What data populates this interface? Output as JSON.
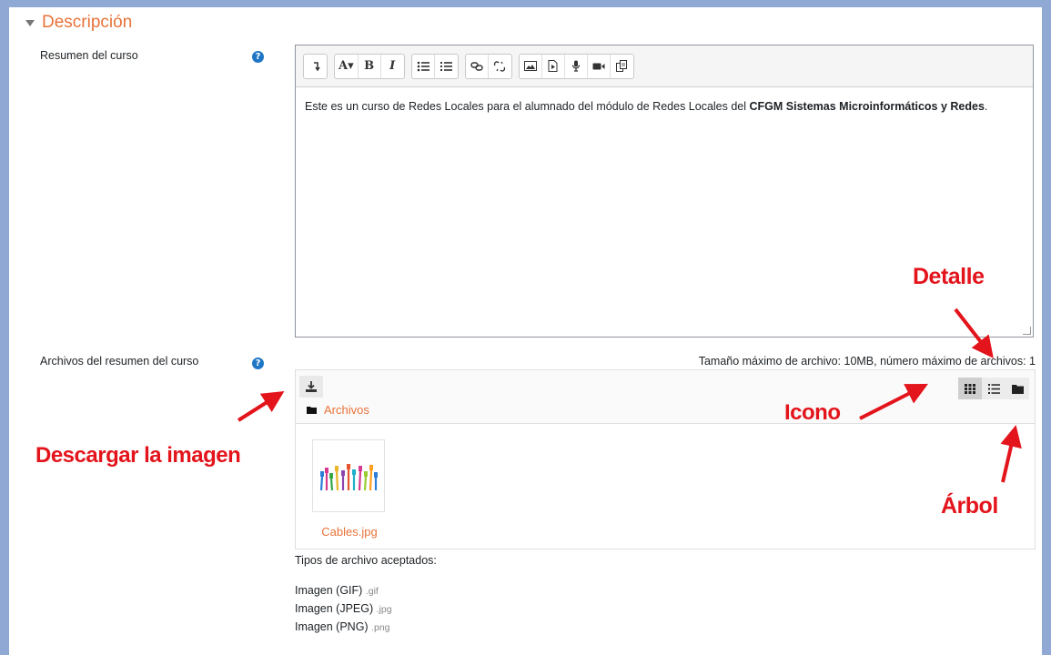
{
  "section": {
    "title": "Descripción"
  },
  "summary": {
    "label": "Resumen del curso",
    "help_glyph": "?",
    "toolbar": [
      {
        "name": "collapse",
        "icon": "collapse-icon"
      },
      {
        "name": "font-style",
        "text": "A▾"
      },
      {
        "name": "bold",
        "text": "B"
      },
      {
        "name": "italic",
        "text": "I"
      },
      {
        "name": "unordered-list",
        "icon": "unordered-list-icon"
      },
      {
        "name": "ordered-list",
        "icon": "ordered-list-icon"
      },
      {
        "name": "link",
        "icon": "link-icon"
      },
      {
        "name": "unlink",
        "icon": "unlink-icon"
      },
      {
        "name": "image",
        "icon": "image-icon"
      },
      {
        "name": "media",
        "icon": "media-icon"
      },
      {
        "name": "record-audio",
        "icon": "microphone-icon"
      },
      {
        "name": "record-video",
        "icon": "video-camera-icon"
      },
      {
        "name": "manage-files",
        "icon": "copy-icon"
      }
    ],
    "text_prefix": "Este es un curso de Redes Locales para el alumnado del módulo de Redes Locales del ",
    "text_bold": "CFGM Sistemas Microinformáticos y Redes",
    "text_suffix": "."
  },
  "files": {
    "label": "Archivos del resumen del curso",
    "help_glyph": "?",
    "limits": "Tamaño máximo de archivo: 10MB, número máximo de archivos: 1",
    "breadcrumb": "Archivos",
    "file_name": "Cables.jpg",
    "accepted_title": "Tipos de archivo aceptados:",
    "types": [
      {
        "name": "Imagen (GIF)",
        "ext": ".gif"
      },
      {
        "name": "Imagen (JPEG)",
        "ext": ".jpg"
      },
      {
        "name": "Imagen (PNG)",
        "ext": ".png"
      }
    ]
  },
  "annotations": {
    "detail": "Detalle",
    "icon": "Icono",
    "tree": "Árbol",
    "download": "Descargar la imagen"
  },
  "colors": {
    "accent": "#e8733a",
    "annotation": "#e3141b",
    "help": "#1f76c4",
    "frame": "#8fa9d4"
  }
}
